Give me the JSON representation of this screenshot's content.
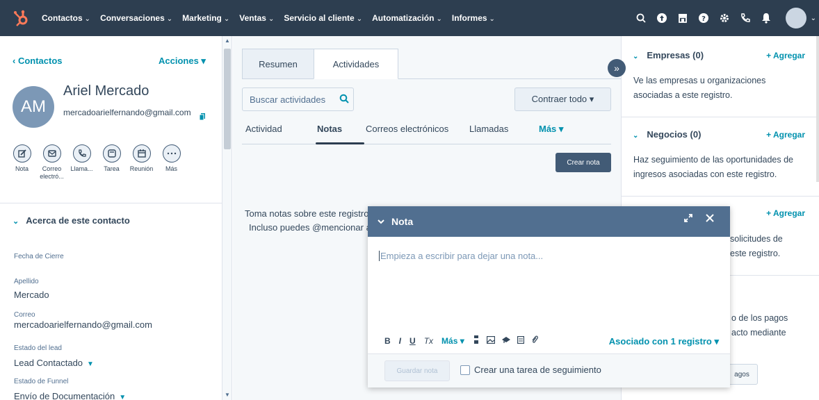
{
  "topnav": {
    "items": [
      {
        "label": "Contactos"
      },
      {
        "label": "Conversaciones"
      },
      {
        "label": "Marketing"
      },
      {
        "label": "Ventas"
      },
      {
        "label": "Servicio al cliente"
      },
      {
        "label": "Automatización"
      },
      {
        "label": "Informes"
      }
    ],
    "icons": [
      "search-icon",
      "upgrade-icon",
      "marketplace-icon",
      "help-icon",
      "settings-icon",
      "calling-icon",
      "notifications-icon"
    ],
    "chevron": "⌄"
  },
  "left": {
    "back_label": "‹ Contactos",
    "acciones_label": "Acciones ▾",
    "avatar_initials": "AM",
    "name": "Ariel Mercado",
    "email": "mercadoarielfernando@gmail.com",
    "actions": [
      {
        "label": "Nota",
        "icon": "edit-icon"
      },
      {
        "label": "Correo electró...",
        "icon": "email-icon"
      },
      {
        "label": "Llama...",
        "icon": "phone-icon"
      },
      {
        "label": "Tarea",
        "icon": "task-icon"
      },
      {
        "label": "Reunión",
        "icon": "calendar-icon"
      },
      {
        "label": "Más",
        "icon": "more-icon"
      }
    ],
    "about_title": "Acerca de este contacto",
    "properties": [
      {
        "label": "Fecha de Cierre",
        "value": ""
      },
      {
        "label": "Apellido",
        "value": "Mercado"
      },
      {
        "label": "Correo",
        "value": "mercadoarielfernando@gmail.com"
      },
      {
        "label": "Estado del lead",
        "value": "Lead Contactado"
      },
      {
        "label": "Estado de Funnel",
        "value": "Envío de Documentación"
      }
    ]
  },
  "middle": {
    "tabs": [
      {
        "label": "Resumen"
      },
      {
        "label": "Actividades"
      }
    ],
    "search_placeholder": "Buscar actividades",
    "contraer_label": "Contraer todo ▾",
    "subtabs": [
      {
        "label": "Actividad"
      },
      {
        "label": "Notas"
      },
      {
        "label": "Correos electrónicos"
      },
      {
        "label": "Llamadas"
      },
      {
        "label": "Más ▾"
      }
    ],
    "crear_nota": "Crear nota",
    "empty_line1": "Toma notas sobre este registro",
    "empty_line2": "Incluso puedes @mencionar a"
  },
  "right": {
    "cards": [
      {
        "title": "Empresas (0)",
        "add": "+ Agregar",
        "text": "Ve las empresas u organizaciones asociadas a este registro."
      },
      {
        "title": "Negocios (0)",
        "add": "+ Agregar",
        "text": "Haz seguimiento de las oportunidades de ingresos asociadas con este registro."
      },
      {
        "title": "",
        "add": "+ Agregar",
        "text1": "solicitudes de",
        "text2": "este registro."
      },
      {
        "title": "",
        "add": "",
        "text1": "o de los pagos",
        "text2": "acto mediante"
      }
    ],
    "pagos_btn": "agos"
  },
  "modal": {
    "title": "Nota",
    "placeholder": "Empieza a escribir para dejar una nota...",
    "toolbar": {
      "bold": "B",
      "italic": "I",
      "underline": "U",
      "clear": "Tx",
      "mas": "Más ▾"
    },
    "asociado": "Asociado con 1 registro ▾",
    "guardar": "Guardar nota",
    "check_label": "Crear una tarea de seguimiento"
  },
  "colors": {
    "nav_bg": "#2d3e50",
    "accent": "#0091ae",
    "modal_head": "#516f90",
    "logo": "#ff7a59"
  }
}
